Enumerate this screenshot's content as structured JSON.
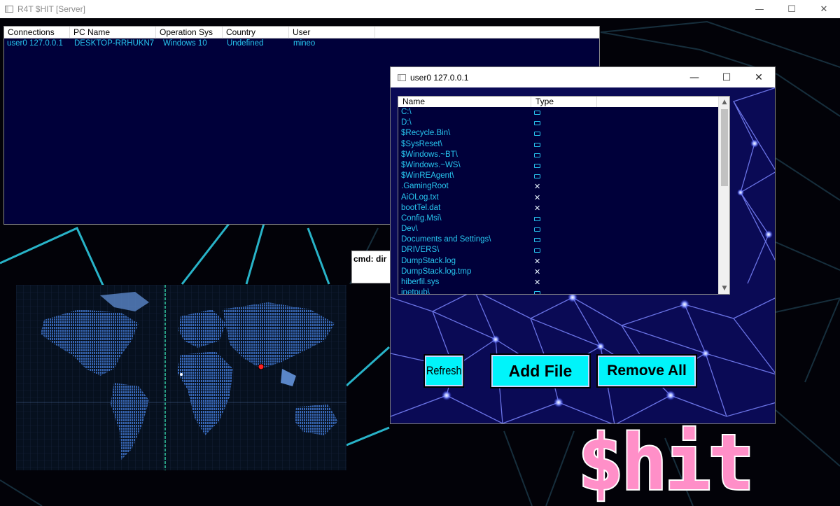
{
  "window": {
    "title": "R4T $HIT [Server]",
    "controls": {
      "minimize": "—",
      "maximize": "☐",
      "close": "✕"
    }
  },
  "connections": {
    "columns": [
      "Connections",
      "PC Name",
      "Operation Sys",
      "Country",
      "User"
    ],
    "rows": [
      [
        "user0 127.0.0.1",
        "DESKTOP-RRHUKN7",
        "Windows 10",
        "Undefined",
        "mineo"
      ]
    ]
  },
  "cmd": {
    "text": "cmd: dir"
  },
  "logo": {
    "text": "$hit"
  },
  "file_window": {
    "title": "user0 127.0.0.1",
    "controls": {
      "minimize": "—",
      "maximize": "☐",
      "close": "✕"
    },
    "columns": [
      "Name",
      "Type"
    ],
    "files": [
      {
        "name": "C:\\",
        "type": "folder"
      },
      {
        "name": "D:\\",
        "type": "folder"
      },
      {
        "name": "$Recycle.Bin\\",
        "type": "folder"
      },
      {
        "name": "$SysReset\\",
        "type": "folder"
      },
      {
        "name": "$Windows.~BT\\",
        "type": "folder"
      },
      {
        "name": "$Windows.~WS\\",
        "type": "folder"
      },
      {
        "name": "$WinREAgent\\",
        "type": "folder"
      },
      {
        "name": ".GamingRoot",
        "type": "file"
      },
      {
        "name": "AiOLog.txt",
        "type": "file"
      },
      {
        "name": "bootTel.dat",
        "type": "file"
      },
      {
        "name": "Config.Msi\\",
        "type": "folder"
      },
      {
        "name": "Dev\\",
        "type": "folder"
      },
      {
        "name": "Documents and Settings\\",
        "type": "folder"
      },
      {
        "name": "DRIVERS\\",
        "type": "folder"
      },
      {
        "name": "DumpStack.log",
        "type": "file"
      },
      {
        "name": "DumpStack.log.tmp",
        "type": "file"
      },
      {
        "name": "hiberfil.sys",
        "type": "file"
      },
      {
        "name": "inetpub\\",
        "type": "folder"
      }
    ],
    "buttons": {
      "refresh": "Refresh",
      "add_file": "Add File",
      "remove_all": "Remove All"
    }
  },
  "colors": {
    "list_bg": "#00003a",
    "list_text": "#27c6f0",
    "button_bg": "#00f4fa",
    "logo_pink": "#ff8fc8"
  }
}
